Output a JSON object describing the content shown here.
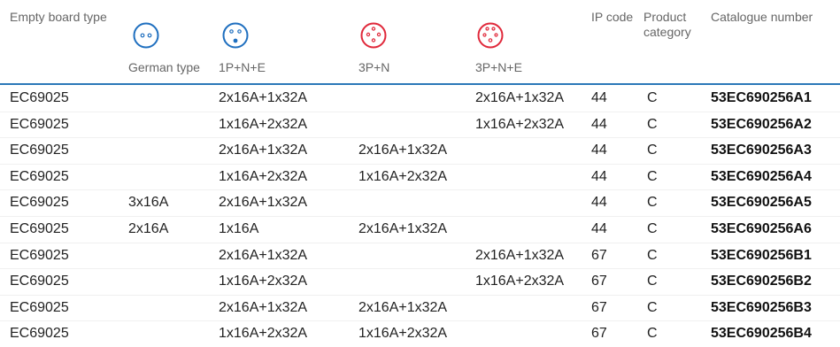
{
  "header": {
    "board_type": "Empty board type",
    "german": "German type",
    "p1ne": "1P+N+E",
    "p3n": "3P+N",
    "p3ne": "3P+N+E",
    "ip": "IP code",
    "category": "Product\ncategory",
    "catalogue": "Catalogue number"
  },
  "icons": {
    "german": "german-socket-icon",
    "p1ne": "blue-socket-1pne-icon",
    "p3n": "red-socket-3pn-icon",
    "p3ne": "red-socket-3pne-icon",
    "blue_color": "#1f6fbf",
    "red_color": "#e0283a"
  },
  "rows": [
    {
      "board": "EC69025",
      "german": "",
      "p1ne": "2x16A+1x32A",
      "p3n": "",
      "p3ne": "2x16A+1x32A",
      "ip": "44",
      "cat": "C",
      "code": "53EC690256A1"
    },
    {
      "board": "EC69025",
      "german": "",
      "p1ne": "1x16A+2x32A",
      "p3n": "",
      "p3ne": "1x16A+2x32A",
      "ip": "44",
      "cat": "C",
      "code": "53EC690256A2"
    },
    {
      "board": "EC69025",
      "german": "",
      "p1ne": "2x16A+1x32A",
      "p3n": "2x16A+1x32A",
      "p3ne": "",
      "ip": "44",
      "cat": "C",
      "code": "53EC690256A3"
    },
    {
      "board": "EC69025",
      "german": "",
      "p1ne": "1x16A+2x32A",
      "p3n": "1x16A+2x32A",
      "p3ne": "",
      "ip": "44",
      "cat": "C",
      "code": "53EC690256A4"
    },
    {
      "board": "EC69025",
      "german": "3x16A",
      "p1ne": "2x16A+1x32A",
      "p3n": "",
      "p3ne": "",
      "ip": "44",
      "cat": "C",
      "code": "53EC690256A5"
    },
    {
      "board": "EC69025",
      "german": "2x16A",
      "p1ne": "1x16A",
      "p3n": "2x16A+1x32A",
      "p3ne": "",
      "ip": "44",
      "cat": "C",
      "code": "53EC690256A6"
    },
    {
      "board": "EC69025",
      "german": "",
      "p1ne": "2x16A+1x32A",
      "p3n": "",
      "p3ne": "2x16A+1x32A",
      "ip": "67",
      "cat": "C",
      "code": "53EC690256B1"
    },
    {
      "board": "EC69025",
      "german": "",
      "p1ne": "1x16A+2x32A",
      "p3n": "",
      "p3ne": "1x16A+2x32A",
      "ip": "67",
      "cat": "C",
      "code": "53EC690256B2"
    },
    {
      "board": "EC69025",
      "german": "",
      "p1ne": "2x16A+1x32A",
      "p3n": "2x16A+1x32A",
      "p3ne": "",
      "ip": "67",
      "cat": "C",
      "code": "53EC690256B3"
    },
    {
      "board": "EC69025",
      "german": "",
      "p1ne": "1x16A+2x32A",
      "p3n": "1x16A+2x32A",
      "p3ne": "",
      "ip": "67",
      "cat": "C",
      "code": "53EC690256B4"
    }
  ]
}
